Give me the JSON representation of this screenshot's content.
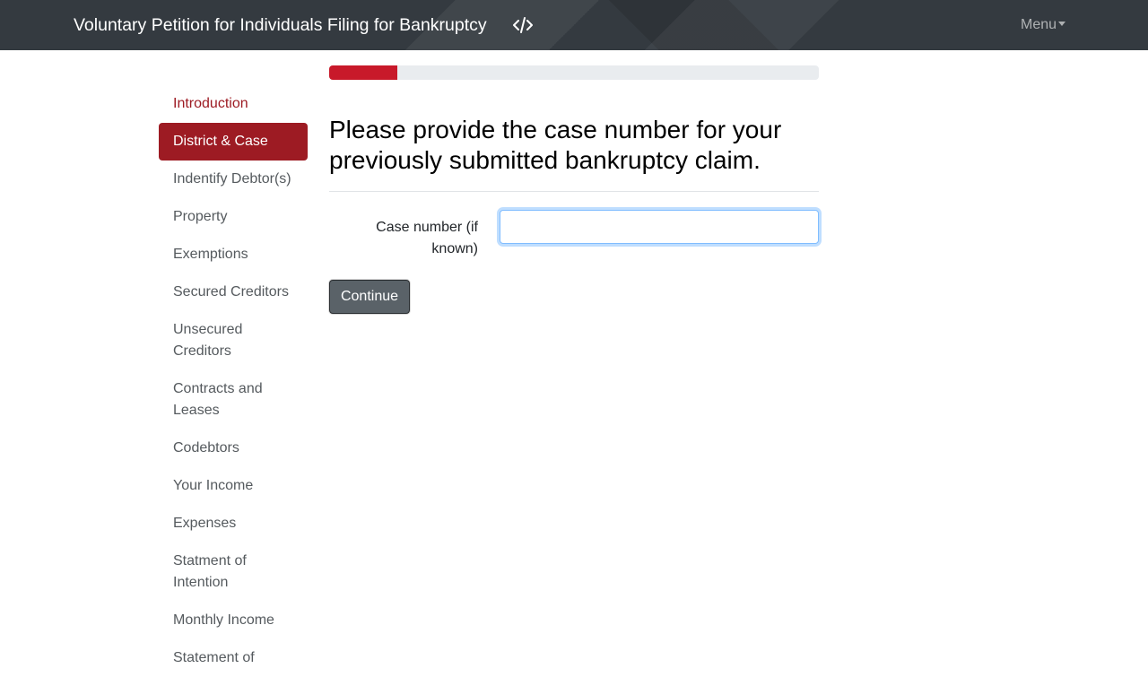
{
  "header": {
    "title": "Voluntary Petition for Individuals Filing for Bankruptcy",
    "source_icon": "code-icon",
    "menu_label": "Menu"
  },
  "progress": {
    "percent": 14,
    "color": "#c8192a"
  },
  "sidebar": {
    "items": [
      {
        "label": "Introduction",
        "state": "visited"
      },
      {
        "label": "District & Case",
        "state": "active"
      },
      {
        "label": "Indentify Debtor(s)",
        "state": "default"
      },
      {
        "label": "Property",
        "state": "default"
      },
      {
        "label": "Exemptions",
        "state": "default"
      },
      {
        "label": "Secured Creditors",
        "state": "default"
      },
      {
        "label": "Unsecured Creditors",
        "state": "default"
      },
      {
        "label": "Contracts and Leases",
        "state": "default"
      },
      {
        "label": "Codebtors",
        "state": "default"
      },
      {
        "label": "Your Income",
        "state": "default"
      },
      {
        "label": "Expenses",
        "state": "default"
      },
      {
        "label": "Statment of Intention",
        "state": "default"
      },
      {
        "label": "Monthly Income",
        "state": "default"
      },
      {
        "label": "Statement of",
        "state": "default"
      }
    ]
  },
  "main": {
    "question": "Please provide the case number for your previously submitted bankruptcy claim.",
    "case_number_label": "Case number (if known)",
    "case_number_value": "",
    "continue_label": "Continue"
  },
  "colors": {
    "accent": "#9d1b23",
    "navbar": "#343a40",
    "focus_border": "#80bdff",
    "button": "#5a6268"
  }
}
